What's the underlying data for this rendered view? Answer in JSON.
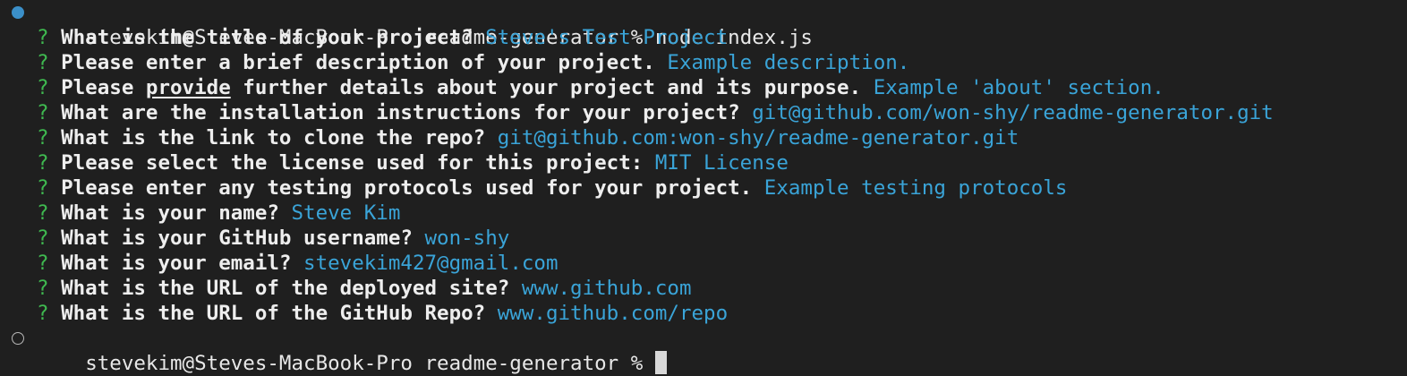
{
  "terminal": {
    "first_prompt": {
      "user_host": "stevekim@Steves-MacBook-Pro",
      "directory": "readme-generator",
      "symbol": "%",
      "command": "node index.js"
    },
    "qa": [
      {
        "mark": "?",
        "question": "What is the title of your project?",
        "answer": "Steve's Test Project"
      },
      {
        "mark": "?",
        "question": "Please enter a brief description of your project.",
        "answer": "Example description."
      },
      {
        "mark": "?",
        "question_before": "Please ",
        "question_underlined": "provide",
        "question_after": " further details about your project and its purpose.",
        "answer": "Example 'about' section."
      },
      {
        "mark": "?",
        "question": "What are the installation instructions for your project?",
        "answer": "git@github.com/won-shy/readme-generator.git"
      },
      {
        "mark": "?",
        "question": "What is the link to clone the repo?",
        "answer": "git@github.com:won-shy/readme-generator.git"
      },
      {
        "mark": "?",
        "question": "Please select the license used for this project:",
        "answer": "MIT License"
      },
      {
        "mark": "?",
        "question": "Please enter any testing protocols used for your project.",
        "answer": "Example testing protocols"
      },
      {
        "mark": "?",
        "question": "What is your name?",
        "answer": "Steve Kim"
      },
      {
        "mark": "?",
        "question": "What is your GitHub username?",
        "answer": "won-shy"
      },
      {
        "mark": "?",
        "question": "What is your email?",
        "answer": "stevekim427@gmail.com"
      },
      {
        "mark": "?",
        "question": "What is the URL of the deployed site?",
        "answer": "www.github.com"
      },
      {
        "mark": "?",
        "question": "What is the URL of the GitHub Repo?",
        "answer": "www.github.com/repo"
      }
    ],
    "second_prompt": {
      "user_host": "stevekim@Steves-MacBook-Pro",
      "directory": "readme-generator",
      "symbol": "%"
    },
    "colors": {
      "background": "#1f1f1f",
      "answer": "#3aa4d8",
      "question_mark": "#3fb950",
      "text": "#e8e8e8",
      "dot_filled": "#3b8fc8"
    }
  }
}
